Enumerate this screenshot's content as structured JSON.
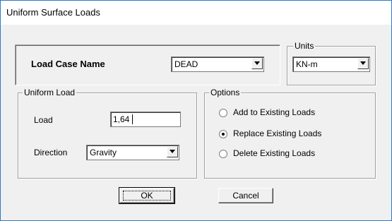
{
  "window": {
    "title": "Uniform Surface Loads"
  },
  "load_case": {
    "label": "Load Case Name",
    "value": "DEAD"
  },
  "units": {
    "legend": "Units",
    "value": "KN-m"
  },
  "uniform_load": {
    "legend": "Uniform Load",
    "load_label": "Load",
    "load_value": "1,64",
    "direction_label": "Direction",
    "direction_value": "Gravity"
  },
  "options": {
    "legend": "Options",
    "items": [
      {
        "label": "Add to Existing Loads",
        "selected": false
      },
      {
        "label": "Replace Existing Loads",
        "selected": true
      },
      {
        "label": "Delete Existing Loads",
        "selected": false
      }
    ]
  },
  "buttons": {
    "ok": "OK",
    "cancel": "Cancel"
  },
  "icons": {
    "dropdown": "chevron-down-icon",
    "radio_on": "radio-selected-icon",
    "radio_off": "radio-unselected-icon"
  }
}
